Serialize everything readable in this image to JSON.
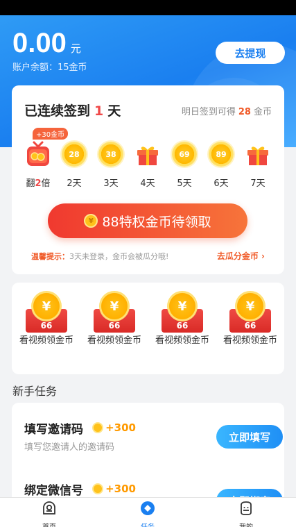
{
  "header": {
    "balance_amount": "0.00",
    "balance_unit": "元",
    "account_balance": "账户余额：15金币",
    "withdraw_button": "去提现"
  },
  "checkin": {
    "title_prefix": "已连续签到",
    "streak_days": "1",
    "title_suffix": "天",
    "tomorrow_prefix": "明日签到可得",
    "tomorrow_coins": "28",
    "tomorrow_suffix": "金币",
    "bonus_badge": "+30金币",
    "days": [
      {
        "label_pre": "翻",
        "label_em": "2",
        "label_post": "倍",
        "kind": "tv-gift"
      },
      {
        "label": "2天",
        "kind": "coin",
        "value": "28"
      },
      {
        "label": "3天",
        "kind": "coin",
        "value": "38"
      },
      {
        "label": "4天",
        "kind": "gift"
      },
      {
        "label": "5天",
        "kind": "coin",
        "value": "69"
      },
      {
        "label": "6天",
        "kind": "coin",
        "value": "89"
      },
      {
        "label": "7天",
        "kind": "gift"
      }
    ],
    "claim_button": "88特权金币待领取",
    "tip_key": "温馨提示：",
    "tip_text": "3天未登录，金币会被瓜分哦!",
    "tip_link": "去瓜分金币",
    "link_icon": "chevron-right-icon"
  },
  "videos": {
    "items": [
      {
        "amount": "66",
        "label": "看视频领金币"
      },
      {
        "amount": "66",
        "label": "看视频领金币"
      },
      {
        "amount": "66",
        "label": "看视频领金币"
      },
      {
        "amount": "66",
        "label": "看视频领金币"
      }
    ]
  },
  "newbie": {
    "section_title": "新手任务",
    "tasks": [
      {
        "name": "填写邀请码",
        "reward": "+300",
        "desc": "填写您邀请人的邀请码",
        "button": "立即填写"
      },
      {
        "name": "绑定微信号",
        "reward": "+300",
        "desc": "",
        "button": "立即绑定"
      }
    ]
  },
  "tabbar": {
    "items": [
      {
        "label": "首页",
        "icon": "home-icon"
      },
      {
        "label": "任务",
        "icon": "task-icon"
      },
      {
        "label": "我的",
        "icon": "profile-icon"
      }
    ]
  },
  "colors": {
    "primary_blue": "#1a7ff0",
    "accent_red": "#f04848",
    "accent_orange": "#f05a28",
    "coin_gold": "#ffc21a"
  }
}
